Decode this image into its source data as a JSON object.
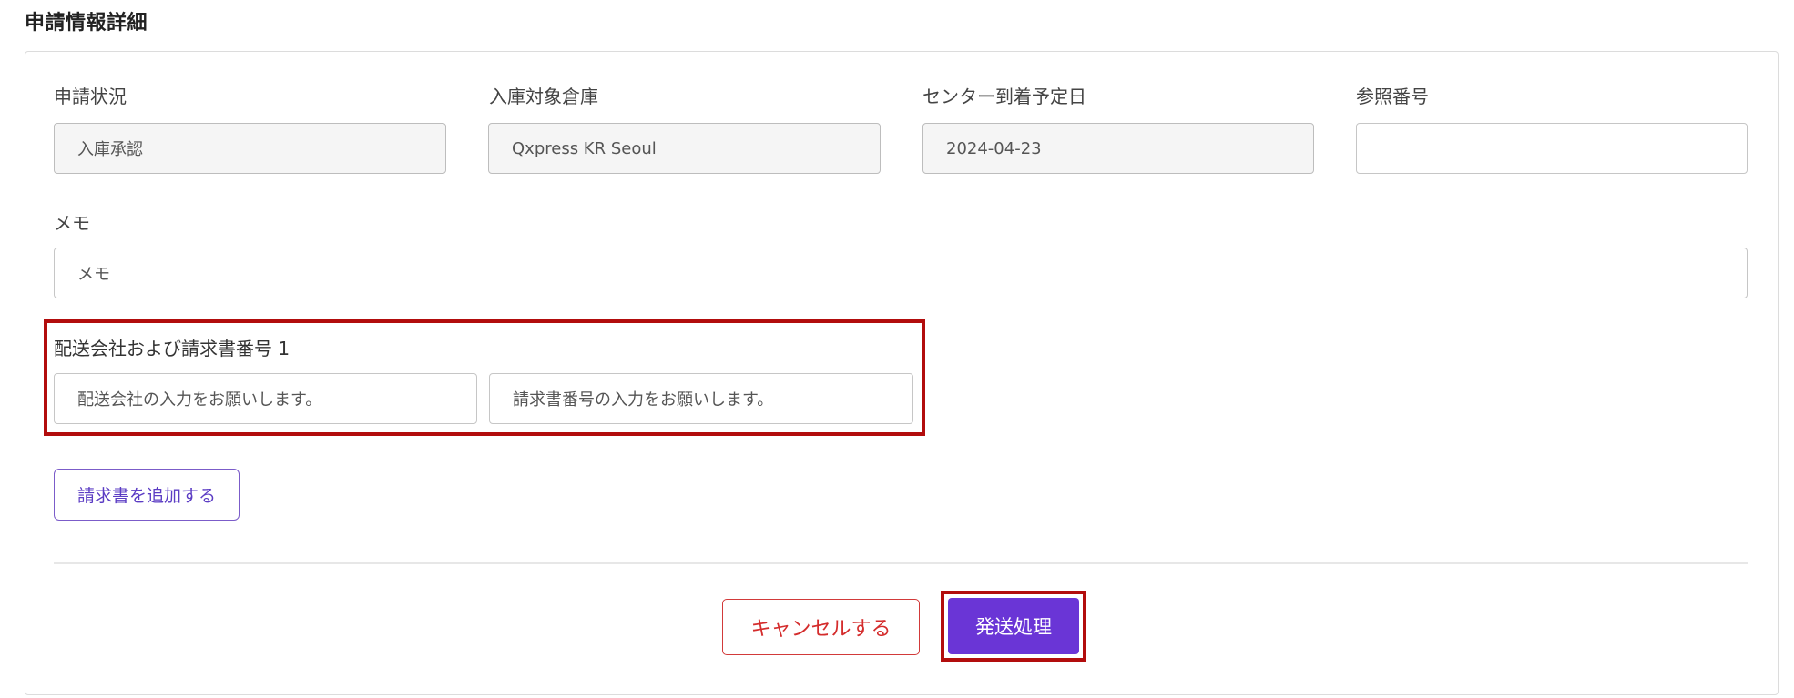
{
  "section": {
    "title": "申請情報詳細"
  },
  "fields": {
    "status": {
      "label": "申請状況",
      "value": "入庫承認"
    },
    "warehouse": {
      "label": "入庫対象倉庫",
      "value": "Qxpress KR Seoul"
    },
    "arrival_date": {
      "label": "センター到着予定日",
      "value": "2024-04-23"
    },
    "reference": {
      "label": "参照番号",
      "value": ""
    },
    "memo": {
      "label": "メモ",
      "placeholder": "メモ"
    }
  },
  "invoice": {
    "label": "配送会社および請求書番号 1",
    "carrier_placeholder": "配送会社の入力をお願いします。",
    "number_placeholder": "請求書番号の入力をお願いします。",
    "add_button": "請求書を追加する"
  },
  "actions": {
    "cancel": "キャンセルする",
    "submit": "発送処理"
  },
  "colors": {
    "accent": "#6a35d6",
    "danger": "#d42c2c",
    "highlight": "#b20d0d"
  }
}
